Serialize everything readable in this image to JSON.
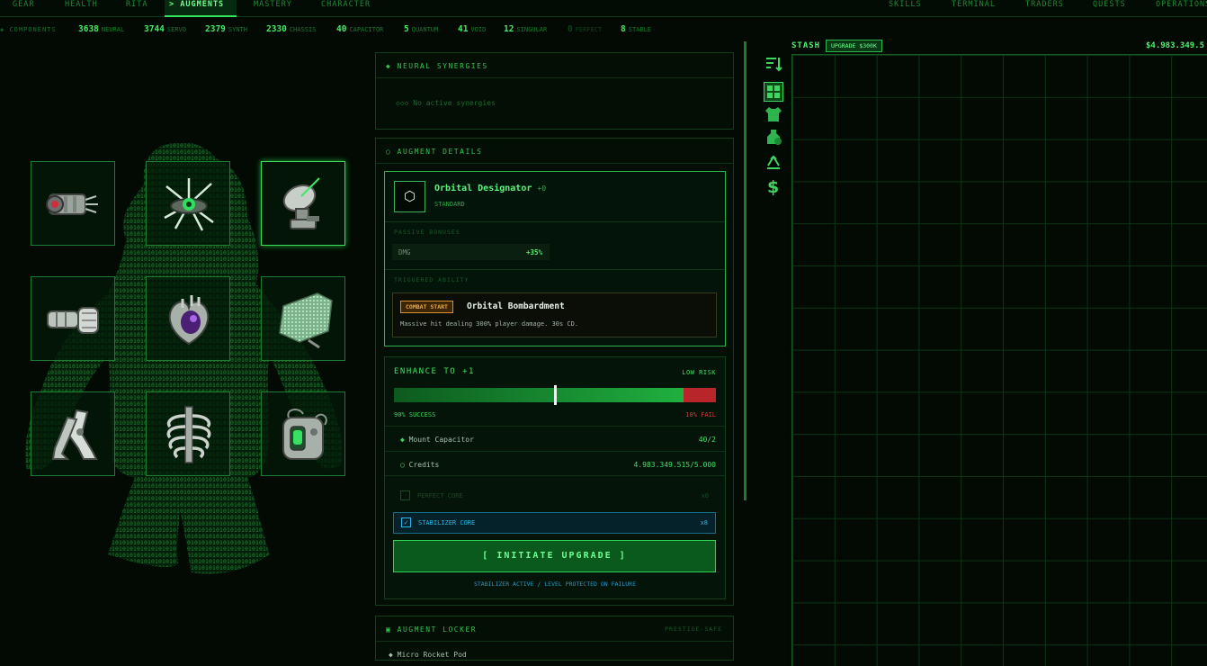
{
  "nav": {
    "left_tabs": [
      "GEAR",
      "HEALTH",
      "RITA",
      "> AUGMENTS",
      "MASTERY",
      "CHARACTER"
    ],
    "right_tabs": [
      "SKILLS",
      "TERMINAL",
      "TRADERS",
      "QUESTS",
      "OPERATIONS"
    ],
    "active": "> AUGMENTS"
  },
  "components": {
    "label": "COMPONENTS",
    "items": [
      {
        "count": "3638",
        "name": "NEURAL"
      },
      {
        "count": "3744",
        "name": "SERVO"
      },
      {
        "count": "2379",
        "name": "SYNTH"
      },
      {
        "count": "2330",
        "name": "CHASSIS"
      },
      {
        "count": "40",
        "name": "CAPACITOR"
      },
      {
        "count": "5",
        "name": "QUANTUM"
      },
      {
        "count": "41",
        "name": "VOID"
      },
      {
        "count": "12",
        "name": "SINGULAR"
      },
      {
        "count": "0",
        "name": "PERFECT"
      },
      {
        "count": "8",
        "name": "STABLE"
      }
    ]
  },
  "synergies": {
    "title": "NEURAL SYNERGIES",
    "empty_text": "◇◇◇ No active synergies"
  },
  "details": {
    "title": "AUGMENT DETAILS",
    "name": "Orbital Designator",
    "level": "+0",
    "rarity": "STANDARD",
    "icon_glyph": "⬡",
    "passive_label": "PASSIVE BONUSES",
    "passive_stat": "DMG",
    "passive_value": "+35%",
    "triggered_label": "TRIGGERED ABILITY",
    "trigger_badge": "COMBAT START",
    "ability_name": "Orbital Bombardment",
    "ability_desc": "Massive hit dealing 300% player damage. 30s CD."
  },
  "enhance": {
    "title": "ENHANCE TO +1",
    "risk": "LOW RISK",
    "success_text": "90% SUCCESS",
    "fail_text": "10% FAIL",
    "success_fraction": 0.9,
    "cost1_label": "Mount Capacitor",
    "cost1_value": "40/2",
    "cost2_label": "Credits",
    "cost2_value": "4.983.349.515/5.000",
    "perfect_label": "PERFECT CORE",
    "perfect_count": "x0",
    "stabilizer_label": "STABILIZER CORE",
    "stabilizer_count": "x8",
    "check_glyph": "✓",
    "button": "[ INITIATE UPGRADE ]",
    "note": "STABILIZER ACTIVE / LEVEL PROTECTED ON FAILURE"
  },
  "locker": {
    "title": "AUGMENT LOCKER",
    "tag": "PRESTIGE-SAFE",
    "first_item": "Micro Rocket Pod"
  },
  "stash": {
    "title": "STASH",
    "upgrade": "UPGRADE $300K",
    "money": "$4.983.349.5"
  },
  "slots": [
    "capacitor-cylinder",
    "neural-chip",
    "satellite-dish",
    "armored-arm",
    "heart-core",
    "mesh-skin",
    "robotic-legs",
    "rib-cage",
    "capacitor-battery"
  ],
  "colors": {
    "accent": "#3ddc5a",
    "fail": "#b8262a",
    "stabilizer": "#1e9fd1",
    "badge": "#d9902a"
  }
}
